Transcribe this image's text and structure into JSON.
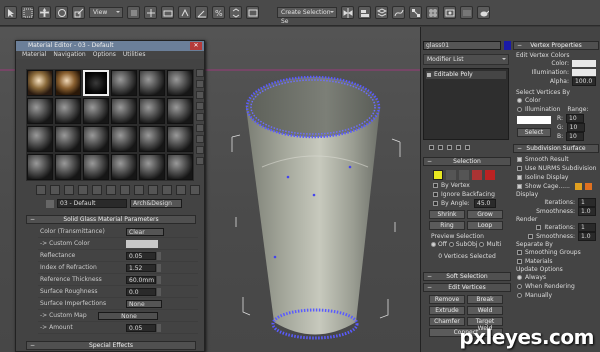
{
  "toolbar": {
    "view_dropdown": "View",
    "selection_set": "Create Selection Se"
  },
  "material_editor": {
    "title": "Material Editor - 03 - Default",
    "menu": [
      "Material",
      "Navigation",
      "Options",
      "Utilities"
    ],
    "material_name": "03 - Default",
    "material_type": "Arch&Design",
    "rollout_title": "Solid Glass Material Parameters",
    "params": [
      {
        "label": "Color (Transmittance)",
        "value": "Clear"
      },
      {
        "label": "-> Custom Color",
        "value": ""
      },
      {
        "label": "Reflectance",
        "value": "0.05"
      },
      {
        "label": "Index of Refraction",
        "value": "1.52"
      },
      {
        "label": "Reference Thickness",
        "value": "60.0mm"
      },
      {
        "label": "Surface Roughness",
        "value": "0.0"
      },
      {
        "label": "Surface Imperfections",
        "value": "None"
      },
      {
        "label": "-> Custom Map",
        "value": "None"
      },
      {
        "label": "-> Amount",
        "value": "0.05"
      }
    ],
    "special_effects": "Special Effects"
  },
  "command_panel": {
    "object_name": "glass01",
    "modifier_list": "Modifier List",
    "stack_item": "Editable Poly",
    "selection": {
      "title": "Selection",
      "by_vertex": "By Vertex",
      "ignore_backfacing": "Ignore Backfacing",
      "by_angle": "By Angle:",
      "angle_value": "45.0",
      "shrink": "Shrink",
      "grow": "Grow",
      "ring": "Ring",
      "loop": "Loop",
      "preview_selection": "Preview Selection",
      "preview_options": [
        "Off",
        "SubObj",
        "Multi"
      ],
      "status": "0 Vertices Selected"
    },
    "soft_selection": "Soft Selection",
    "edit_vertices": {
      "title": "Edit Vertices",
      "buttons": [
        "Remove",
        "Break",
        "Extrude",
        "Weld",
        "Chamfer",
        "Target Weld",
        "Connect"
      ]
    },
    "vertex_properties": {
      "title": "Vertex Properties",
      "edit_colors": "Edit Vertex Colors",
      "color": "Color:",
      "illumination": "Illumination:",
      "alpha": "Alpha:",
      "alpha_value": "100.0"
    },
    "select_by": {
      "title": "Select Vertices By",
      "color": "Color",
      "illumination": "Illumination",
      "range": "Range:",
      "r": "10",
      "g": "10",
      "b": "10",
      "select": "Select"
    },
    "subdivision": {
      "title": "Subdivision Surface",
      "smooth_result": "Smooth Result",
      "use_nurms": "Use NURMS Subdivision",
      "isoline": "Isoline Display",
      "show_cage": "Show Cage......",
      "display": "Display",
      "iterations": "Iterations:",
      "iter_val": "1",
      "smoothness": "Smoothness:",
      "smooth_val": "1.0",
      "render": "Render",
      "separate_by": "Separate By",
      "smoothing_groups": "Smoothing Groups",
      "materials": "Materials",
      "update_options": "Update Options",
      "always": "Always",
      "when_rendering": "When Rendering",
      "manually": "Manually"
    }
  },
  "watermark": "pxleyes.com"
}
